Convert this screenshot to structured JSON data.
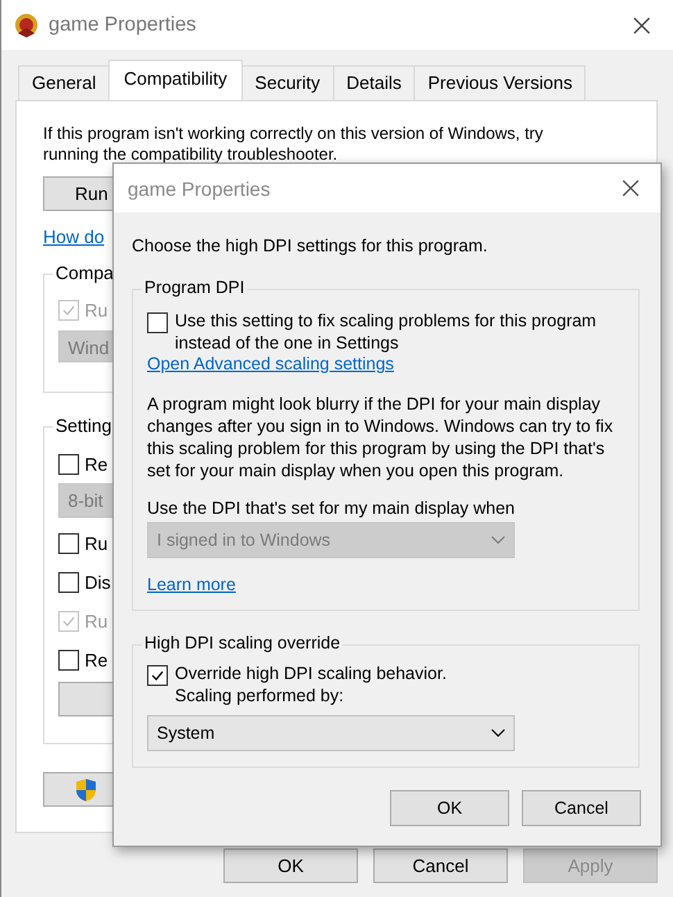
{
  "main_window": {
    "title": "game Properties",
    "tabs": [
      {
        "label": "General",
        "selected": false
      },
      {
        "label": "Compatibility",
        "selected": true
      },
      {
        "label": "Security",
        "selected": false
      },
      {
        "label": "Details",
        "selected": false
      },
      {
        "label": "Previous Versions",
        "selected": false
      }
    ],
    "intro": "If this program isn't working correctly on this version of Windows, try running the compatibility troubleshooter.",
    "troubleshooter_button": "Run",
    "help_link": "How do",
    "compat_group": {
      "label": "Compa",
      "checkbox": {
        "label": "Ru",
        "checked": true,
        "disabled": true
      },
      "dropdown": {
        "value": "Wind",
        "disabled": true
      }
    },
    "settings_group": {
      "label": "Setting",
      "items": [
        {
          "kind": "checkbox",
          "label": "Re",
          "checked": false,
          "disabled": false
        },
        {
          "kind": "dropdown",
          "value": "8-bit",
          "disabled": true
        },
        {
          "kind": "checkbox",
          "label": "Ru",
          "checked": false,
          "disabled": false
        },
        {
          "kind": "checkbox",
          "label": "Dis",
          "checked": false,
          "disabled": false
        },
        {
          "kind": "checkbox",
          "label": "Ru",
          "checked": true,
          "disabled": true
        },
        {
          "kind": "checkbox",
          "label": "Re",
          "checked": false,
          "disabled": false
        },
        {
          "kind": "button"
        }
      ]
    },
    "buttons": [
      {
        "label": "OK",
        "disabled": false
      },
      {
        "label": "Cancel",
        "disabled": false
      },
      {
        "label": "Apply",
        "disabled": true
      }
    ]
  },
  "dialog": {
    "title": "game Properties",
    "prompt": "Choose the high DPI settings for this program.",
    "program_dpi": {
      "label": "Program DPI",
      "checkbox": {
        "label": "Use this setting to fix scaling problems for this program instead of the one in Settings",
        "checked": false
      },
      "link": "Open Advanced scaling settings",
      "description": "A program might look blurry if the DPI for your main display changes after you sign in to Windows. Windows can try to fix this scaling problem for this program by using the DPI that's set for your main display when you open this program.",
      "when_label": "Use the DPI that's set for my main display when",
      "dropdown": {
        "value": "I signed in to Windows",
        "disabled": true
      },
      "learn_more": "Learn more"
    },
    "override": {
      "label": "High DPI scaling override",
      "checkbox": {
        "lines": [
          "Override high DPI scaling behavior.",
          "Scaling performed by:"
        ],
        "checked": true
      },
      "dropdown": {
        "value": "System",
        "disabled": false
      }
    },
    "buttons": [
      {
        "label": "OK"
      },
      {
        "label": "Cancel"
      }
    ]
  }
}
